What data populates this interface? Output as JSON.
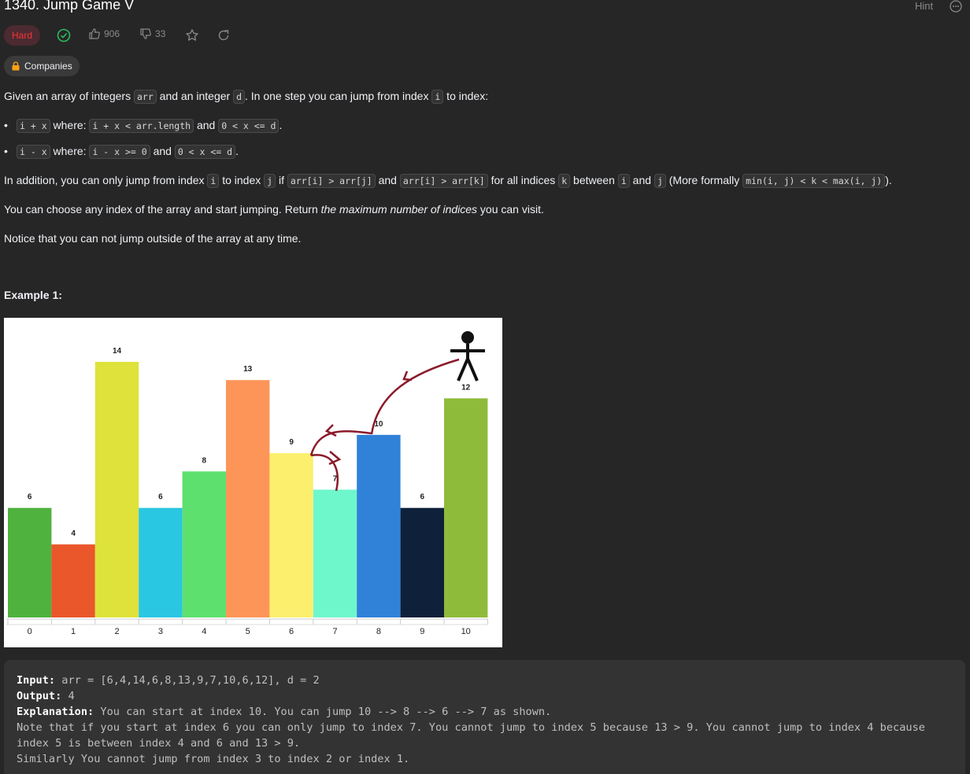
{
  "problem": {
    "title": "1340. Jump Game V",
    "hint_label": "Hint",
    "difficulty": "Hard",
    "likes": "906",
    "dislikes": "33",
    "companies_label": "Companies"
  },
  "description": {
    "p1_a": "Given an array of integers ",
    "p1_code1": "arr",
    "p1_b": " and an integer ",
    "p1_code2": "d",
    "p1_c": ". In one step you can jump from index ",
    "p1_code3": "i",
    "p1_d": " to index:",
    "b1_code1": "i + x",
    "b1_a": " where: ",
    "b1_code2": "i + x < arr.length",
    "b1_b": " and ",
    "b1_code3": "0 < x <= d",
    "b1_c": ".",
    "b2_code1": "i - x",
    "b2_a": " where: ",
    "b2_code2": "i - x >= 0",
    "b2_b": " and ",
    "b2_code3": "0 < x <= d",
    "b2_c": ".",
    "p2_a": "In addition, you can only jump from index ",
    "p2_code1": "i",
    "p2_b": " to index ",
    "p2_code2": "j",
    "p2_c": " if ",
    "p2_code3": "arr[i] > arr[j]",
    "p2_d": " and ",
    "p2_code4": "arr[i] > arr[k]",
    "p2_e": " for all indices ",
    "p2_code5": "k",
    "p2_f": " between ",
    "p2_code6": "i",
    "p2_g": " and ",
    "p2_code7": "j",
    "p2_h": " (More formally ",
    "p2_code8": "min(i, j) < k < max(i, j)",
    "p2_i": ").",
    "p3_a": "You can choose any index of the array and start jumping. Return ",
    "p3_em": "the maximum number of indices",
    "p3_b": " you can visit.",
    "p4": "Notice that you can not jump outside of the array at any time."
  },
  "example": {
    "title": "Example 1:",
    "input_label": "Input:",
    "input_value": " arr = [6,4,14,6,8,13,9,7,10,6,12], d = 2",
    "output_label": "Output:",
    "output_value": " 4",
    "explanation_label": "Explanation:",
    "explanation_value": " You can start at index 10. You can jump 10 --> 8 --> 6 --> 7 as shown.",
    "note_line": "Note that if you start at index 6 you can only jump to index 7. You cannot jump to index 5 because 13 > 9. You cannot jump to index 4 because index 5 is between index 4 and 6 and 13 > 9.",
    "similar_line": "Similarly You cannot jump from index 3 to index 2 or index 1."
  },
  "chart_data": {
    "type": "bar",
    "categories": [
      "0",
      "1",
      "2",
      "3",
      "4",
      "5",
      "6",
      "7",
      "8",
      "9",
      "10"
    ],
    "values": [
      6,
      4,
      14,
      6,
      8,
      13,
      9,
      7,
      10,
      6,
      12
    ],
    "colors": [
      "#4fb23e",
      "#e9572a",
      "#dee23b",
      "#2ac7e2",
      "#5ee06f",
      "#fd9559",
      "#fdef6e",
      "#6ff7cc",
      "#3081d8",
      "#0f213a",
      "#8fbb3a"
    ],
    "arrow_color": "#8b1a2b",
    "title": "",
    "xlabel": "",
    "ylabel": "",
    "ylim": [
      0,
      14
    ]
  }
}
